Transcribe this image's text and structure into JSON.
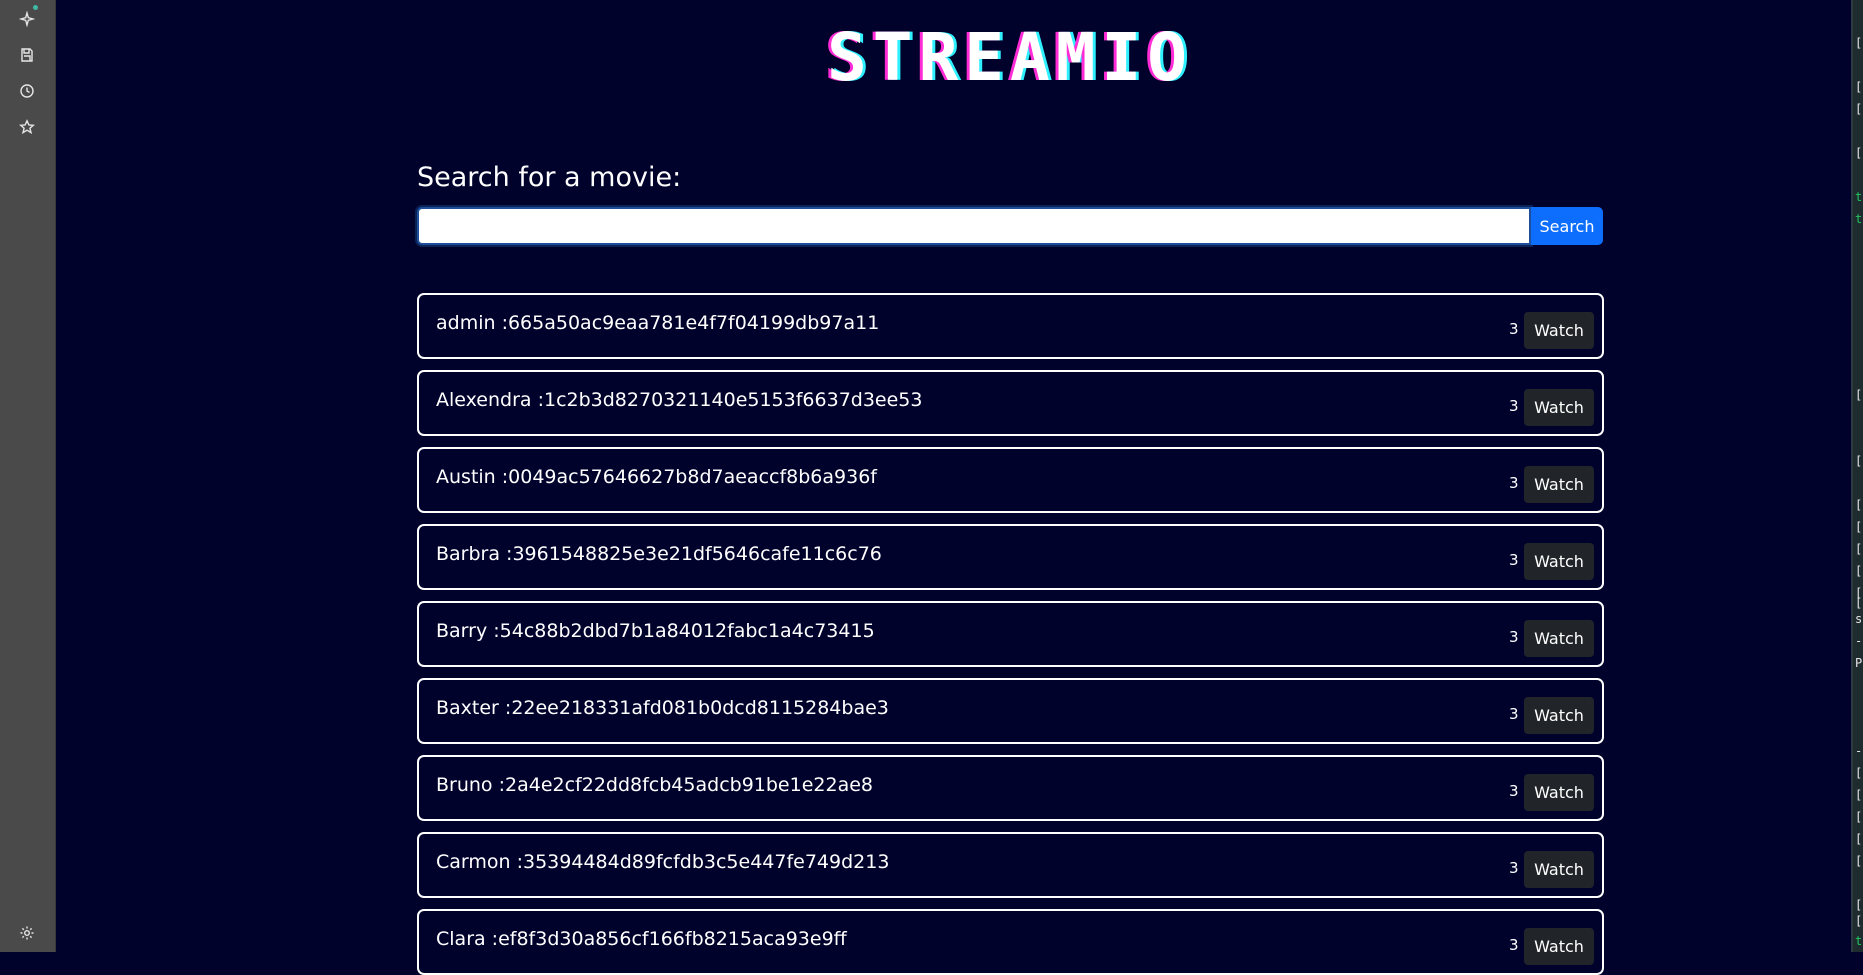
{
  "sidebar": {
    "icons": [
      "sparkle-icon",
      "save-icon",
      "history-icon",
      "star-icon",
      "settings-icon"
    ]
  },
  "logo": {
    "text": "STREAMIO"
  },
  "search": {
    "label": "Search for a movie:",
    "value": "",
    "button": "Search"
  },
  "results": [
    {
      "text": "admin :665a50ac9eaa781e4f7f04199db97a11",
      "count": "3",
      "button": "Watch"
    },
    {
      "text": "Alexendra :1c2b3d8270321140e5153f6637d3ee53",
      "count": "3",
      "button": "Watch"
    },
    {
      "text": "Austin :0049ac57646627b8d7aeaccf8b6a936f",
      "count": "3",
      "button": "Watch"
    },
    {
      "text": "Barbra :3961548825e3e21df5646cafe11c6c76",
      "count": "3",
      "button": "Watch"
    },
    {
      "text": "Barry :54c88b2dbd7b1a84012fabc1a4c73415",
      "count": "3",
      "button": "Watch"
    },
    {
      "text": "Baxter :22ee218331afd081b0dcd8115284bae3",
      "count": "3",
      "button": "Watch"
    },
    {
      "text": "Bruno :2a4e2cf22dd8fcb45adcb91be1e22ae8",
      "count": "3",
      "button": "Watch"
    },
    {
      "text": "Carmon :35394484d89fcfdb3c5e447fe749d213",
      "count": "3",
      "button": "Watch"
    },
    {
      "text": "Clara :ef8f3d30a856cf166fb8215aca93e9ff",
      "count": "3",
      "button": "Watch"
    }
  ],
  "terminal_strip": {
    "lines": [
      "[",
      "[",
      "[",
      "[",
      "t",
      "t",
      "[",
      "[",
      "[",
      "[",
      "[",
      "[",
      "[",
      "[",
      "s",
      "-",
      "P",
      "-",
      "[",
      "[",
      "[",
      "[",
      "[",
      "[",
      "[",
      "t"
    ]
  }
}
